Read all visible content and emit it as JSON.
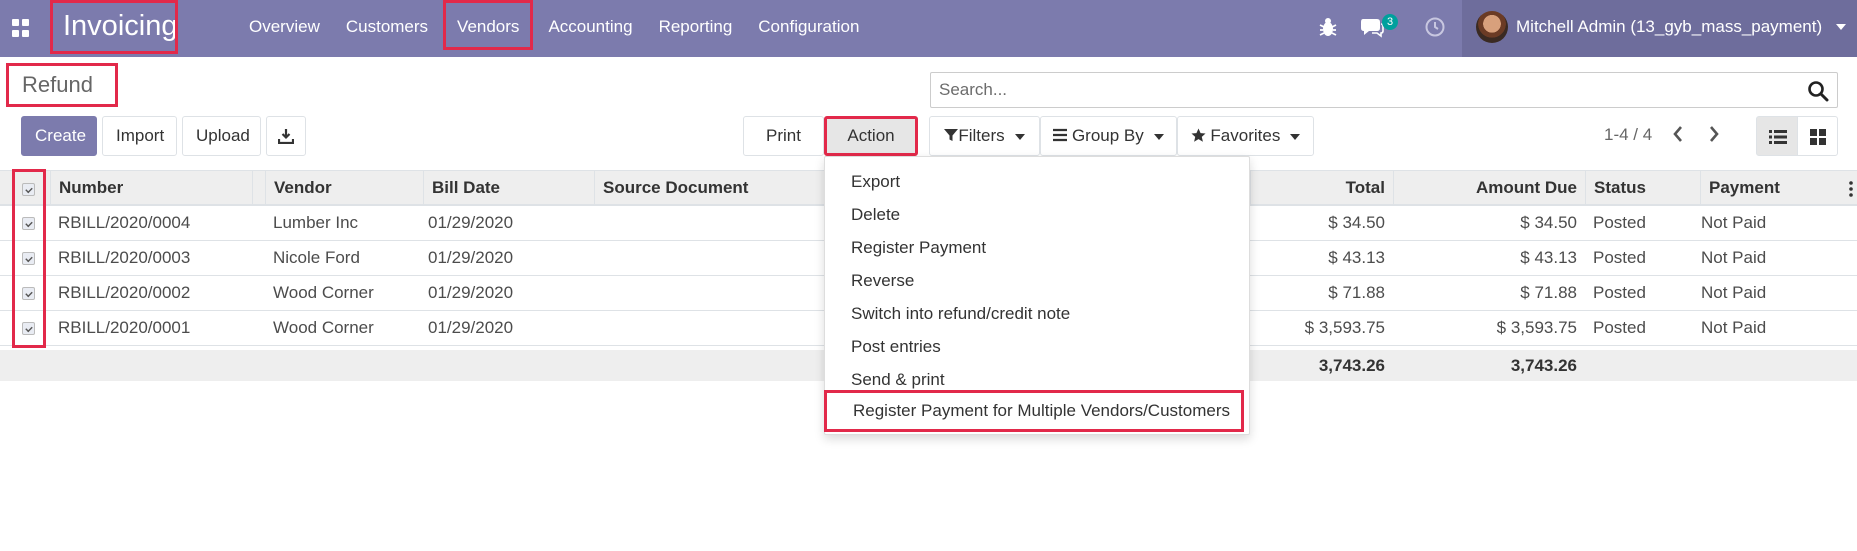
{
  "navbar": {
    "brand": "Invoicing",
    "menu": [
      "Overview",
      "Customers",
      "Vendors",
      "Accounting",
      "Reporting",
      "Configuration"
    ],
    "chat_count": "3",
    "user_name": "Mitchell Admin (13_gyb_mass_payment)"
  },
  "control_panel": {
    "title": "Refund",
    "search_placeholder": "Search...",
    "create_label": "Create",
    "import_label": "Import",
    "upload_label": "Upload",
    "print_label": "Print",
    "action_label": "Action",
    "filters_label": "Filters",
    "groupby_label": "Group By",
    "favorites_label": "Favorites",
    "pager": "1-4 / 4"
  },
  "table": {
    "columns": [
      "Number",
      "Vendor",
      "Bill Date",
      "Source Document",
      "Total",
      "Amount Due",
      "Status",
      "Payment"
    ],
    "rows": [
      {
        "number": "RBILL/2020/0004",
        "vendor": "Lumber Inc",
        "date": "01/29/2020",
        "total": "$ 34.50",
        "due": "$ 34.50",
        "status": "Posted",
        "payment": "Not Paid"
      },
      {
        "number": "RBILL/2020/0003",
        "vendor": "Nicole Ford",
        "date": "01/29/2020",
        "total": "$ 43.13",
        "due": "$ 43.13",
        "status": "Posted",
        "payment": "Not Paid"
      },
      {
        "number": "RBILL/2020/0002",
        "vendor": "Wood Corner",
        "date": "01/29/2020",
        "total": "$ 71.88",
        "due": "$ 71.88",
        "status": "Posted",
        "payment": "Not Paid"
      },
      {
        "number": "RBILL/2020/0001",
        "vendor": "Wood Corner",
        "date": "01/29/2020",
        "total": "$ 3,593.75",
        "due": "$ 3,593.75",
        "status": "Posted",
        "payment": "Not Paid"
      }
    ],
    "footer_total": "3,743.26",
    "footer_due": "3,743.26"
  },
  "action_menu": {
    "items": [
      "Export",
      "Delete",
      "Register Payment",
      "Reverse",
      "Switch into refund/credit note",
      "Post entries",
      "Send & print",
      "Register Payment for Multiple Vendors/Customers"
    ]
  },
  "colors": {
    "brand": "#7c7bad",
    "highlight": "#e2294a",
    "badge": "#00a09d"
  }
}
